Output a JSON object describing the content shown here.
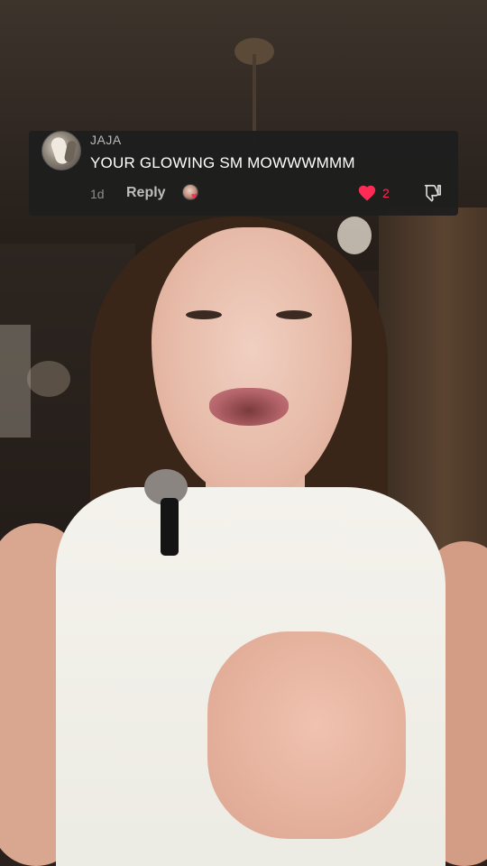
{
  "comment": {
    "username": "JAJA",
    "text": "YOUR GLOWING SM MOWWWMMM",
    "timestamp": "1d",
    "reply_label": "Reply",
    "like_count": "2",
    "creator_liked": true
  },
  "icons": {
    "avatar": "user-avatar",
    "creator_liked": "creator-liked-heart-icon",
    "like": "heart-icon",
    "dislike": "thumbs-down-icon"
  },
  "colors": {
    "like_red": "#fe2c55",
    "card_bg": "#1e1e1e",
    "text_primary": "#ffffff",
    "text_secondary": "#8e8e8e"
  }
}
